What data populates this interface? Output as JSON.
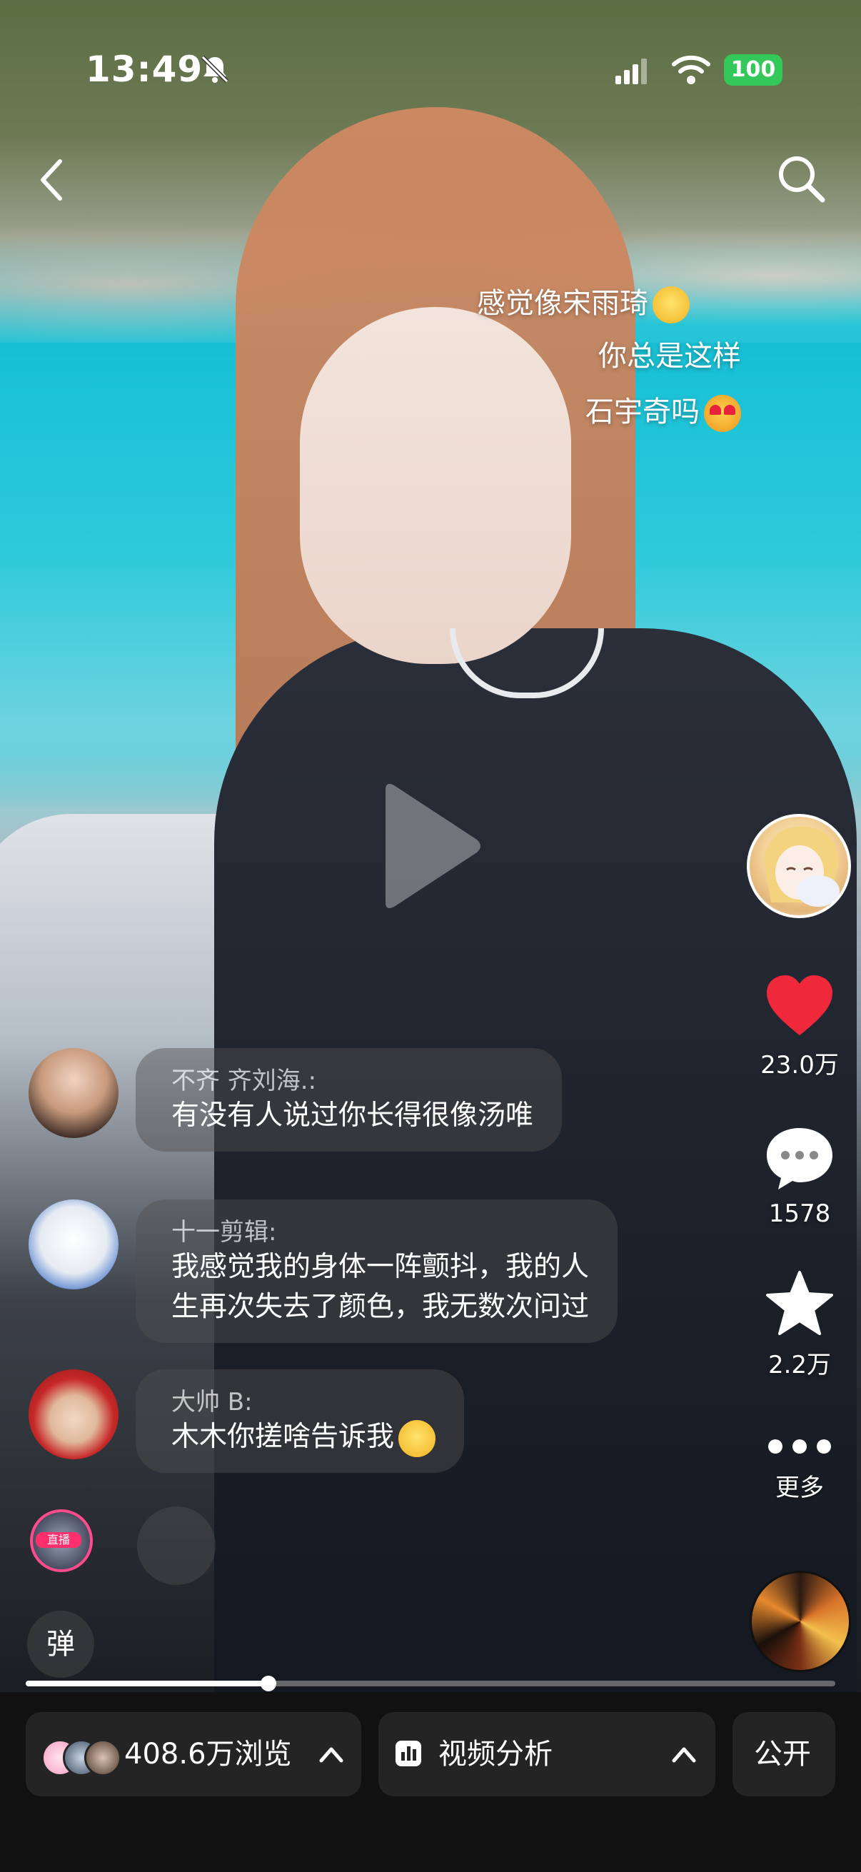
{
  "status_bar": {
    "time": "13:49",
    "battery": "100"
  },
  "overlay_lines": [
    "感觉像宋雨琦",
    "你总是这样",
    "石宇奇吗"
  ],
  "right_rail": {
    "like_count": "23.0万",
    "comment_count": "1578",
    "favorite_count": "2.2万",
    "more_label": "更多"
  },
  "comments": [
    {
      "name": "不齐 齐刘海.:",
      "lines": [
        "有没有人说过你长得很像汤唯"
      ]
    },
    {
      "name": "十一剪辑:",
      "lines": [
        "我感觉我的身体一阵颤抖，我的人",
        "生再次失去了颜色，我无数次问过"
      ]
    },
    {
      "name": "大帅 B:",
      "lines": [
        "木木你搓啥告诉我"
      ]
    }
  ],
  "live_tag": "直播",
  "danmaku_button": "弹",
  "progress": {
    "fraction": 0.3
  },
  "bottom_bar": {
    "views": "408.6万浏览",
    "analysis": "视频分析",
    "visibility": "公开"
  },
  "colors": {
    "like_red": "#f0283c",
    "battery_green": "#34c759",
    "live_pink": "#ff2f6d"
  }
}
